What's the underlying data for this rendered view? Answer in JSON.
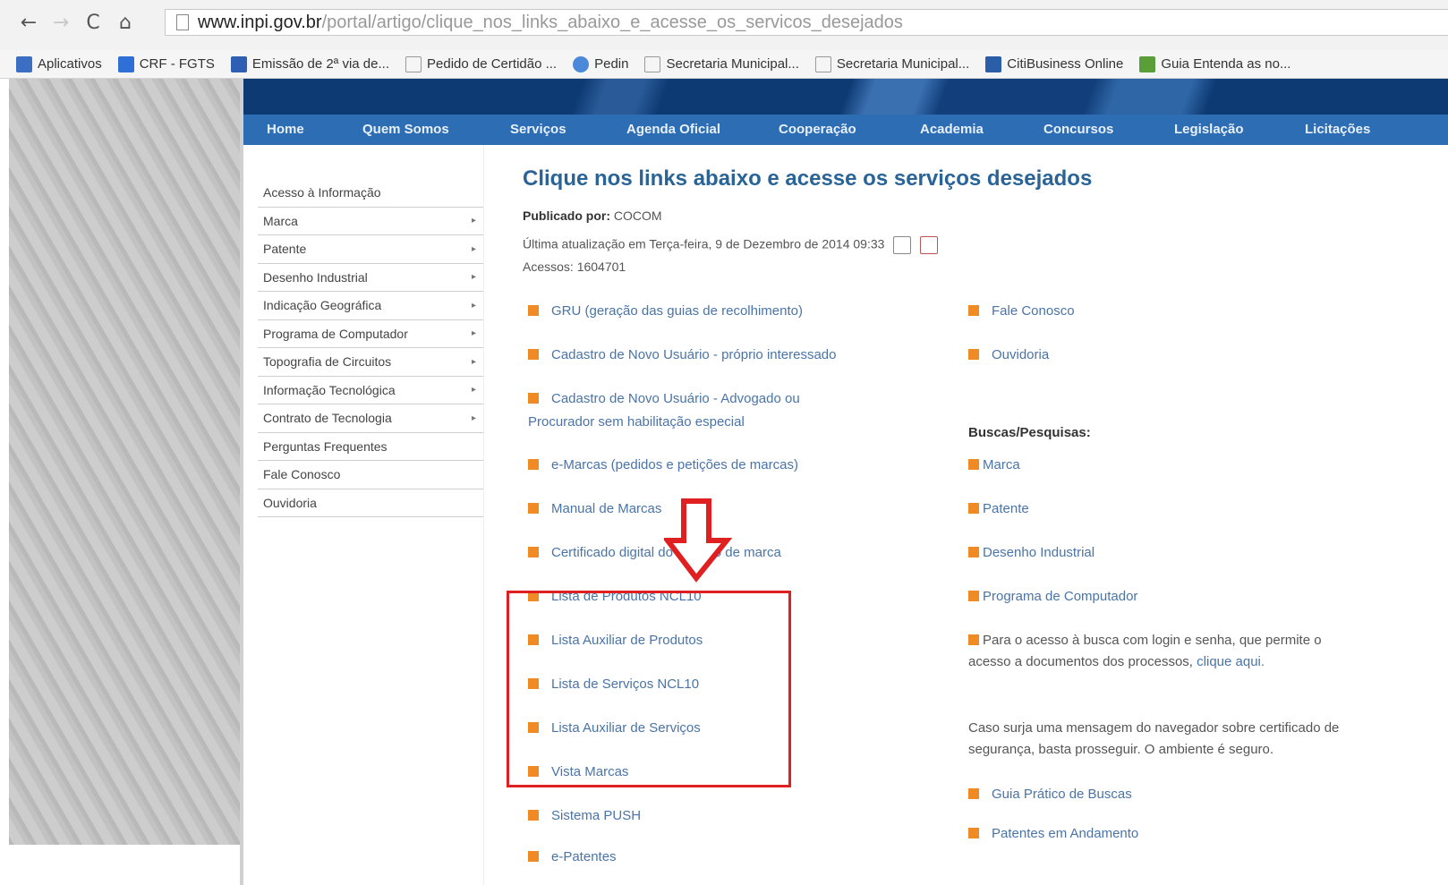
{
  "browser": {
    "url_host": "www.inpi.gov.br",
    "url_path": "/portal/artigo/clique_nos_links_abaixo_e_acesse_os_servicos_desejados",
    "bookmarks": [
      {
        "label": "Aplicativos",
        "icon": "apps-icon",
        "color": "#3b6fc4"
      },
      {
        "label": "CRF - FGTS",
        "icon": "bookmark-icon",
        "color": "#2f6fd6"
      },
      {
        "label": "Emissão de 2ª via de...",
        "icon": "bookmark-icon",
        "color": "#2f5fb4"
      },
      {
        "label": "Pedido de Certidão ...",
        "icon": "page-icon",
        "color": "#cccccc"
      },
      {
        "label": "Pedin",
        "icon": "globe-icon",
        "color": "#4a89d8"
      },
      {
        "label": "Secretaria Municipal...",
        "icon": "page-icon",
        "color": "#cccccc"
      },
      {
        "label": "Secretaria Municipal...",
        "icon": "page-icon",
        "color": "#cccccc"
      },
      {
        "label": "CitiBusiness Online",
        "icon": "citi-icon",
        "color": "#2a5ea8"
      },
      {
        "label": "Guia Entenda as no...",
        "icon": "download-icon",
        "color": "#5a9e3a"
      }
    ]
  },
  "nav": {
    "items": [
      "Home",
      "Quem Somos",
      "Serviços",
      "Agenda Oficial",
      "Cooperação",
      "Academia",
      "Concursos",
      "Legislação",
      "Licitações"
    ]
  },
  "sidebar": {
    "items": [
      {
        "label": "Acesso à Informação",
        "arrow": ""
      },
      {
        "label": "Marca",
        "arrow": "▸"
      },
      {
        "label": "Patente",
        "arrow": "▸"
      },
      {
        "label": "Desenho Industrial",
        "arrow": "▸"
      },
      {
        "label": "Indicação Geográfica",
        "arrow": "▸"
      },
      {
        "label": "Programa de Computador",
        "arrow": "▸"
      },
      {
        "label": "Topografia de Circuitos",
        "arrow": "▸"
      },
      {
        "label": "Informação Tecnológica",
        "arrow": "▸"
      },
      {
        "label": "Contrato de Tecnologia",
        "arrow": "▸"
      },
      {
        "label": "Perguntas Frequentes",
        "arrow": ""
      },
      {
        "label": "Fale Conosco",
        "arrow": ""
      },
      {
        "label": "Ouvidoria",
        "arrow": ""
      }
    ]
  },
  "article": {
    "title": "Clique nos links abaixo e acesse os serviços desejados",
    "published_label": "Publicado por:",
    "published_by": "COCOM",
    "updated": "Última atualização em Terça-feira, 9 de Dezembro de 2014 09:33",
    "accesses": "Acessos: 1604701",
    "left_links": [
      "GRU (geração das guias de recolhimento)",
      "Cadastro de Novo Usuário - próprio interessado",
      "Cadastro de Novo Usuário - Advogado ou",
      "Procurador sem habilitação especial",
      "e-Marcas (pedidos e petições de marcas)",
      "Manual de Marcas",
      "Certificado digital do registro de marca",
      "Lista de Produtos NCL10",
      "Lista Auxiliar de Produtos",
      "Lista de Serviços NCL10",
      "Lista Auxiliar de Serviços",
      "Vista Marcas",
      "Sistema PUSH",
      "e-Patentes"
    ],
    "right_links": [
      "Fale Conosco",
      "Ouvidoria"
    ],
    "search_heading": "Buscas/Pesquisas:",
    "search_links": [
      "Marca",
      "Patente",
      "Desenho Industrial",
      "Programa de Computador"
    ],
    "login_text_1": "Para o acesso à busca com login e senha, que permite o",
    "login_text_2": "acesso a documentos dos processos,",
    "login_link": "clique aqui.",
    "cert_text_1": "Caso surja uma mensagem do navegador sobre certificado de",
    "cert_text_2": "segurança, basta prosseguir. O ambiente é seguro.",
    "extra_links": [
      "Guia Prático de Buscas",
      "Patentes em Andamento"
    ]
  },
  "colors": {
    "nav_bar": "#2d6db4",
    "title": "#2a6496",
    "bullet": "#f08a24",
    "link": "#4a74a8",
    "highlight": "#e02020"
  }
}
